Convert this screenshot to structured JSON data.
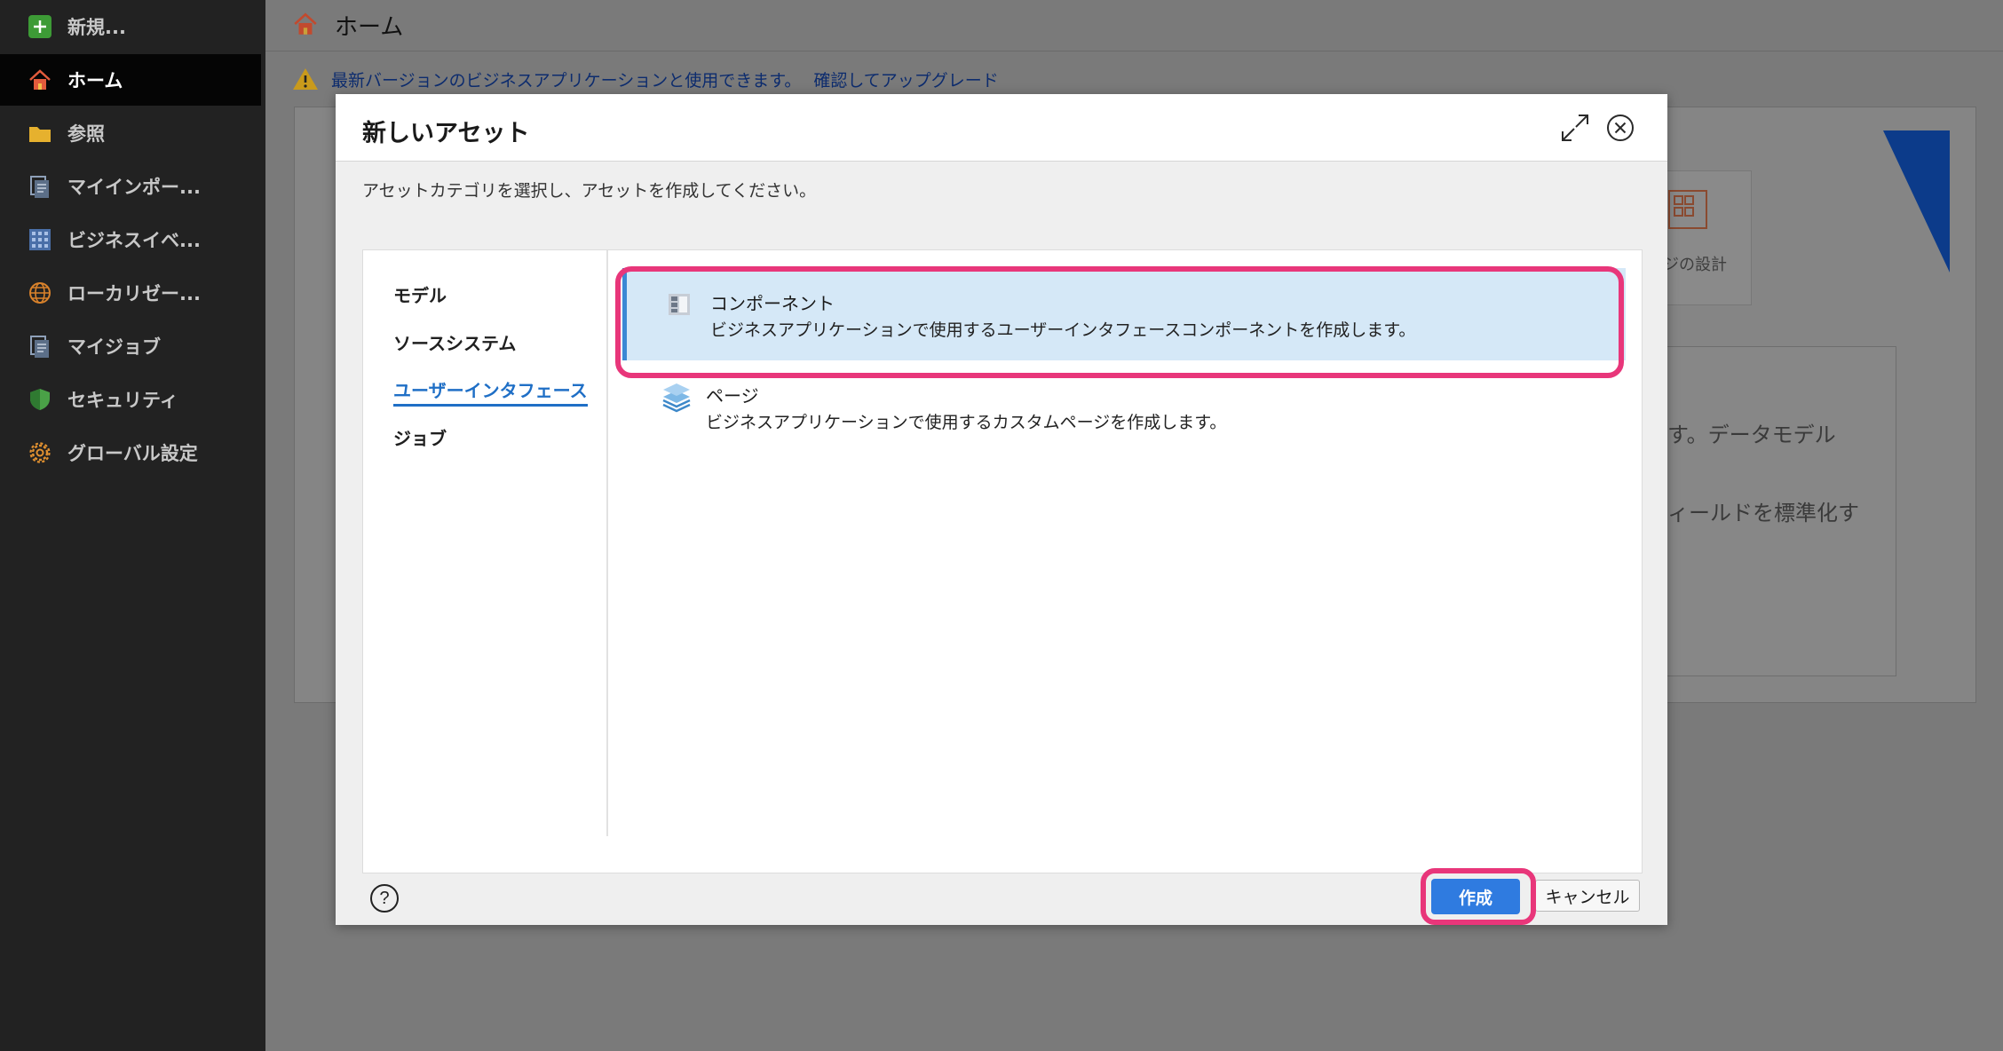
{
  "sidebar": {
    "items": [
      {
        "label": "新規...",
        "icon": "plus-icon"
      },
      {
        "label": "ホーム",
        "icon": "home-icon",
        "active": true
      },
      {
        "label": "参照",
        "icon": "folder-icon"
      },
      {
        "label": "マイインポー...",
        "icon": "document-icon"
      },
      {
        "label": "ビジネスイベ...",
        "icon": "grid-icon"
      },
      {
        "label": "ローカリゼー...",
        "icon": "globe-icon"
      },
      {
        "label": "マイジョブ",
        "icon": "document-icon"
      },
      {
        "label": "セキュリティ",
        "icon": "shield-icon"
      },
      {
        "label": "グローバル設定",
        "icon": "gear-icon"
      }
    ]
  },
  "main": {
    "title": "ホーム",
    "upgrade_message": "最新バージョンのビジネスアプリケーションと使用できます。",
    "upgrade_link": "確認してアップグレード",
    "bg_tile_label": "ジの設計",
    "bg_text_1": "す。データモデル",
    "bg_text_2": "ィールドを標準化す"
  },
  "dialog": {
    "title": "新しいアセット",
    "description": "アセットカテゴリを選択し、アセットを作成してください。",
    "categories": [
      {
        "label": "モデル"
      },
      {
        "label": "ソースシステム"
      },
      {
        "label": "ユーザーインタフェース",
        "active": true
      },
      {
        "label": "ジョブ"
      }
    ],
    "assets": [
      {
        "name": "コンポーネント",
        "description": "ビジネスアプリケーションで使用するユーザーインタフェースコンポーネントを作成します。",
        "icon": "component-icon",
        "selected": true
      },
      {
        "name": "ページ",
        "description": "ビジネスアプリケーションで使用するカスタムページを作成します。",
        "icon": "layers-icon"
      }
    ],
    "help_label": "?",
    "create_label": "作成",
    "cancel_label": "キャンセル"
  },
  "colors": {
    "accent": "#2f7be0",
    "highlight": "#e8367a",
    "selected_bg": "#d5e8f7",
    "sidebar_bg": "#222222"
  }
}
